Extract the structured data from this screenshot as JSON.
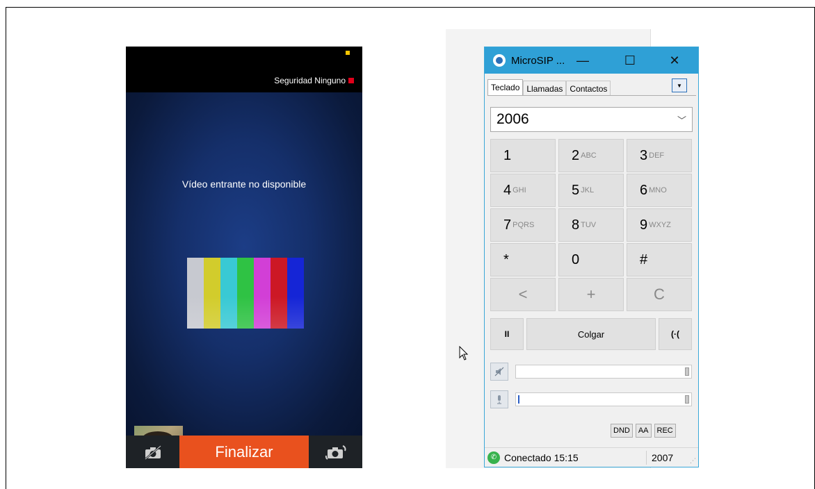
{
  "phone": {
    "security_label": "Seguridad Ninguno",
    "video_message": "Vídeo entrante no disponible",
    "end_button": "Finalizar",
    "color_bars": [
      "#c7c9d0",
      "#d2cc2c",
      "#39c9d4",
      "#2fc244",
      "#d23fd6",
      "#cc1825",
      "#1525d6"
    ],
    "accent": "#e9511e"
  },
  "microsip": {
    "title": "MicroSIP ...",
    "titlebar_color": "#2fa0d6",
    "tabs": [
      "Teclado",
      "Llamadas",
      "Contactos"
    ],
    "active_tab": "Teclado",
    "dial_value": "2006",
    "keys": [
      {
        "digit": "1",
        "letters": ""
      },
      {
        "digit": "2",
        "letters": "ABC"
      },
      {
        "digit": "3",
        "letters": "DEF"
      },
      {
        "digit": "4",
        "letters": "GHI"
      },
      {
        "digit": "5",
        "letters": "JKL"
      },
      {
        "digit": "6",
        "letters": "MNO"
      },
      {
        "digit": "7",
        "letters": "PQRS"
      },
      {
        "digit": "8",
        "letters": "TUV"
      },
      {
        "digit": "9",
        "letters": "WXYZ"
      },
      {
        "digit": "*",
        "letters": ""
      },
      {
        "digit": "0",
        "letters": ""
      },
      {
        "digit": "#",
        "letters": ""
      }
    ],
    "edit_keys": [
      "<",
      "+",
      "C"
    ],
    "hold_label": "II",
    "hangup_label": "Colgar",
    "transfer_label": "⋅⋅",
    "small_buttons": [
      "DND",
      "AA",
      "REC"
    ],
    "status_text": "Conectado 15:15",
    "extension": "2007"
  }
}
